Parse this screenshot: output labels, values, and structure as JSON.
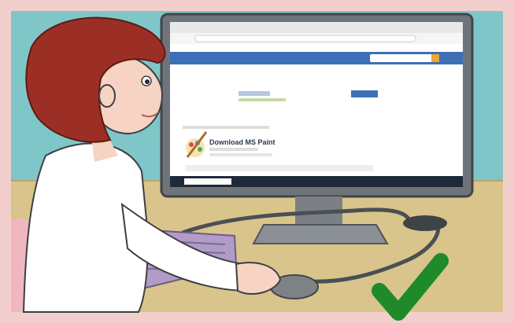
{
  "scene": {
    "type": "illustration",
    "screen": {
      "app_name": "wikiHow-style article page",
      "heading": "Download MS Paint"
    },
    "check_mark_color": "#1f8a2a",
    "border_color": "#f2cfcc",
    "checkmark_icon": "check-icon"
  }
}
